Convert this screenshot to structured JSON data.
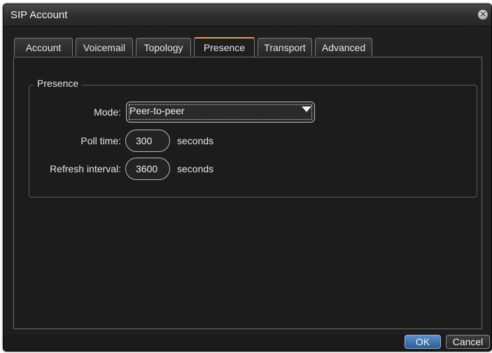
{
  "window": {
    "title": "SIP Account",
    "close_icon": "close-icon"
  },
  "tabs": [
    {
      "label": "Account",
      "active": false
    },
    {
      "label": "Voicemail",
      "active": false
    },
    {
      "label": "Topology",
      "active": false
    },
    {
      "label": "Presence",
      "active": true
    },
    {
      "label": "Transport",
      "active": false
    },
    {
      "label": "Advanced",
      "active": false
    }
  ],
  "presence": {
    "group_title": "Presence",
    "mode_label": "Mode:",
    "mode_value": "Peer-to-peer",
    "poll_label": "Poll time:",
    "poll_value": "300",
    "poll_unit": "seconds",
    "refresh_label": "Refresh interval:",
    "refresh_value": "3600",
    "refresh_unit": "seconds"
  },
  "buttons": {
    "ok": "OK",
    "cancel": "Cancel"
  },
  "colors": {
    "active_tab_accent": "#e2a23a",
    "ok_button": "#3f74b3"
  }
}
